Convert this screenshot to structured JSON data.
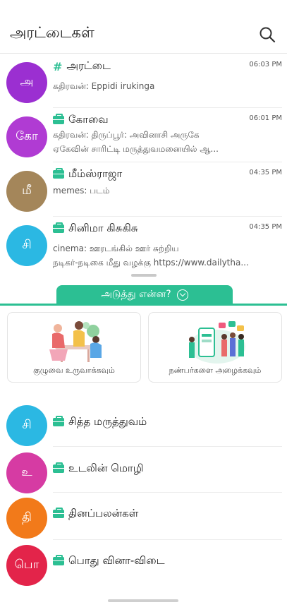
{
  "header": {
    "title": "அரட்டைகள்",
    "search_icon": "search-icon"
  },
  "chats": [
    {
      "avatar": "அ",
      "avatar_color": "#9b2fd1",
      "icon": "hash-icon",
      "title": "அரட்டை",
      "time": "06:03 PM",
      "lines": [
        "கதிரவன்: Eppidi irukinga"
      ]
    },
    {
      "avatar": "கோ",
      "avatar_color": "#b03bd3",
      "icon": "briefcase-icon",
      "title": "கோவை",
      "time": "06:01 PM",
      "lines": [
        "கதிரவன்: திருப்பூர்: அவினாசி அருகே",
        "ஏகேவின் சாரிட்டி மருத்துவமனையில் ஆ..."
      ]
    },
    {
      "avatar": "மீ",
      "avatar_color": "#a4865a",
      "icon": "briefcase-icon",
      "title": "மீம்ஸ்ராஜா",
      "time": "04:35 PM",
      "lines": [
        "memes: படம்"
      ]
    },
    {
      "avatar": "சி",
      "avatar_color": "#2bb8e3",
      "icon": "briefcase-icon",
      "title": "சினிமா கிசுகிசு",
      "time": "04:35 PM",
      "lines": [
        "cinema: ஊரடங்கில் ஊர் சுற்றிய",
        "நடிகர்-நடிகை மீது வழக்கு https://www.dailytha..."
      ]
    }
  ],
  "whats_next": {
    "label": "அடுத்து என்ன?"
  },
  "cards": [
    {
      "label": "குழுவை உருவாக்கவும்",
      "illustration": "group-illustration"
    },
    {
      "label": "நண்பர்களை அழைக்கவும்",
      "illustration": "invite-illustration"
    }
  ],
  "suggested": [
    {
      "avatar": "சி",
      "avatar_color": "#2bb8e3",
      "title": "சித்த மருத்துவம்"
    },
    {
      "avatar": "உ",
      "avatar_color": "#d63ba3",
      "title": "உடலின் மொழி"
    },
    {
      "avatar": "தி",
      "avatar_color": "#f27a1a",
      "title": "தினப்பலன்கள்"
    },
    {
      "avatar": "பொ",
      "avatar_color": "#e3244a",
      "title": "பொது வினா-விடை"
    }
  ],
  "colors": {
    "accent": "#2cbf93"
  }
}
